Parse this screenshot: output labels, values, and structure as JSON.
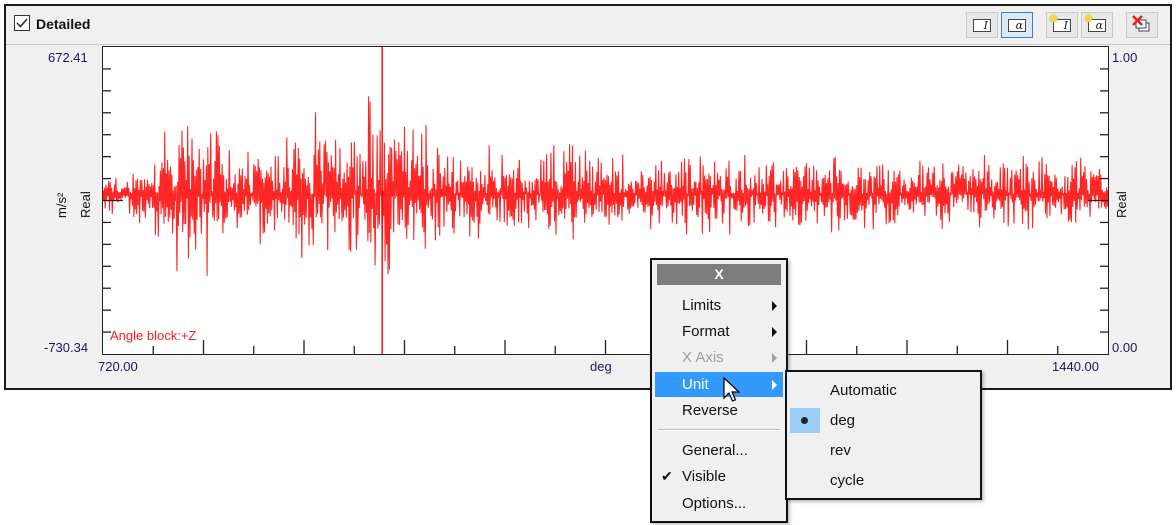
{
  "panel": {
    "title": "Detailed",
    "checked": true,
    "toolbar": [
      {
        "name": "text-label-button",
        "glyph": "I",
        "active": false
      },
      {
        "name": "alpha-label-button",
        "glyph": "α",
        "active": true
      },
      {
        "name": "new-text-label-button",
        "glyph": "I",
        "active": false
      },
      {
        "name": "new-alpha-label-button",
        "glyph": "α",
        "active": false
      },
      {
        "name": "delete-labels-button",
        "glyph": "",
        "active": false
      }
    ]
  },
  "chart_data": {
    "type": "line",
    "title": "",
    "series_label": "Angle block:+Z",
    "series_color": "#ff0000",
    "xlabel": "deg",
    "ylabel_left": "Real",
    "ylabel_left_unit": "m/s²",
    "ylabel_right": "Real",
    "xlim": [
      720.0,
      1440.0
    ],
    "ylim": [
      -730.34,
      672.41
    ],
    "y2lim": [
      0.0,
      1.0
    ],
    "x_tick_labels": [
      "720.00",
      "1440.00"
    ],
    "y_tick_labels": [
      "672.41",
      "-730.34"
    ],
    "y2_tick_labels": [
      "1.00",
      "0.00"
    ],
    "x_major_ticks": 8,
    "grid": false,
    "description": "Dense vibration signal oscillating around 0 with bursts of larger amplitude near 760-800 deg and 910-930 deg (peak ≈672 at ~920 deg, trough ≈-730 at ~920 deg)",
    "envelope": [
      {
        "x": 720,
        "amp": 120
      },
      {
        "x": 750,
        "amp": 200
      },
      {
        "x": 770,
        "amp": 480
      },
      {
        "x": 790,
        "amp": 520
      },
      {
        "x": 810,
        "amp": 250
      },
      {
        "x": 840,
        "amp": 340
      },
      {
        "x": 860,
        "amp": 420
      },
      {
        "x": 890,
        "amp": 360
      },
      {
        "x": 910,
        "amp": 520
      },
      {
        "x": 920,
        "amp": 700
      },
      {
        "x": 935,
        "amp": 450
      },
      {
        "x": 960,
        "amp": 300
      },
      {
        "x": 990,
        "amp": 260
      },
      {
        "x": 1030,
        "amp": 220
      },
      {
        "x": 1060,
        "amp": 330
      },
      {
        "x": 1100,
        "amp": 200
      },
      {
        "x": 1150,
        "amp": 250
      },
      {
        "x": 1200,
        "amp": 200
      },
      {
        "x": 1250,
        "amp": 250
      },
      {
        "x": 1300,
        "amp": 170
      },
      {
        "x": 1350,
        "amp": 220
      },
      {
        "x": 1400,
        "amp": 200
      },
      {
        "x": 1440,
        "amp": 190
      }
    ]
  },
  "context_menu": {
    "header": "X",
    "items": [
      {
        "label": "Limits",
        "submenu": true,
        "disabled": false
      },
      {
        "label": "Format",
        "submenu": true,
        "disabled": false
      },
      {
        "label": "X Axis",
        "submenu": true,
        "disabled": true
      },
      {
        "label": "Unit",
        "submenu": true,
        "disabled": false,
        "highlighted": true
      },
      {
        "label": "Reverse",
        "submenu": false,
        "disabled": false
      },
      {
        "label": "General...",
        "submenu": false,
        "disabled": false
      },
      {
        "label": "Visible",
        "submenu": false,
        "disabled": false,
        "checked": true
      },
      {
        "label": "Options...",
        "submenu": false,
        "disabled": false
      }
    ]
  },
  "unit_submenu": {
    "items": [
      {
        "label": "Automatic",
        "selected": false
      },
      {
        "label": "deg",
        "selected": true
      },
      {
        "label": "rev",
        "selected": false
      },
      {
        "label": "cycle",
        "selected": false
      }
    ]
  }
}
